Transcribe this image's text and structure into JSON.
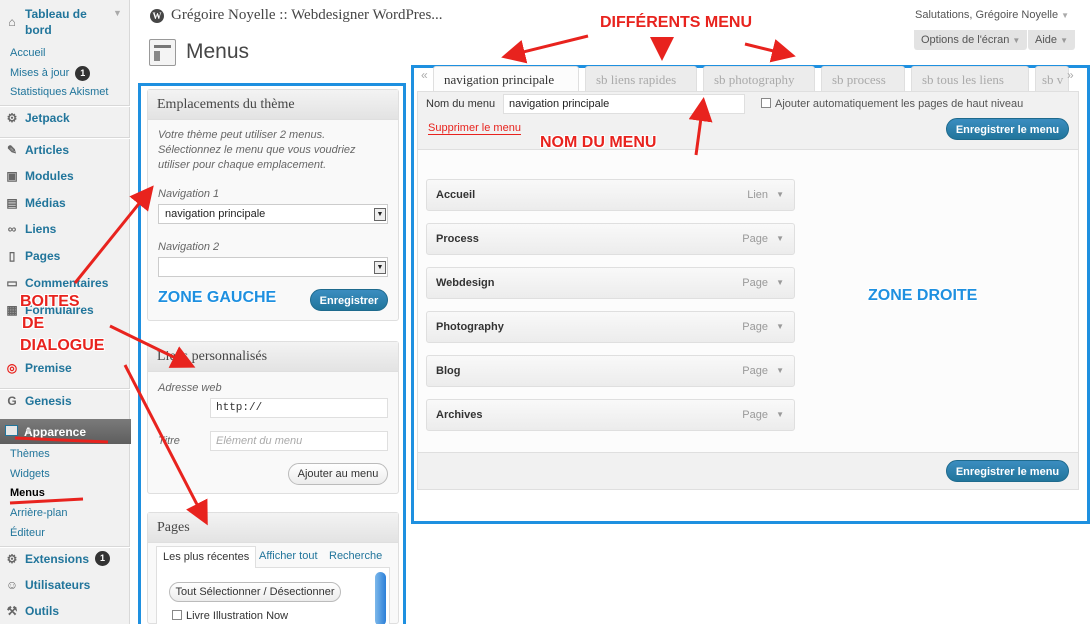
{
  "header": {
    "site_title": "Grégoire Noyelle :: Webdesigner WordPres...",
    "greeting": "Salutations, Grégoire Noyelle",
    "screen_options": "Options de l'écran",
    "help": "Aide"
  },
  "page": {
    "title": "Menus"
  },
  "sidebar": {
    "dashboard": "Tableau de",
    "dashboard2": "bord",
    "sub": [
      "Accueil",
      "Mises à jour",
      "Statistiques Akismet"
    ],
    "updates_count": "1",
    "items": [
      {
        "label": "Jetpack",
        "icon": "jetpack-icon"
      },
      {
        "label": "Articles",
        "icon": "pin-icon"
      },
      {
        "label": "Modules",
        "icon": "modules-icon"
      },
      {
        "label": "Médias",
        "icon": "media-icon"
      },
      {
        "label": "Liens",
        "icon": "link-icon"
      },
      {
        "label": "Pages",
        "icon": "pages-icon"
      },
      {
        "label": "Commentaires",
        "icon": "comment-icon"
      },
      {
        "label": "Formulaires",
        "icon": "form-icon"
      },
      {
        "label": "Premise",
        "icon": "premise-icon"
      },
      {
        "label": "Genesis",
        "icon": "genesis-icon"
      },
      {
        "label": "Apparence",
        "icon": "appearance-icon"
      },
      {
        "label": "Extensions",
        "icon": "plugins-icon"
      },
      {
        "label": "Utilisateurs",
        "icon": "users-icon"
      },
      {
        "label": "Outils",
        "icon": "tools-icon"
      }
    ],
    "appearance_sub": [
      "Thèmes",
      "Widgets",
      "Menus",
      "Arrière-plan",
      "Éditeur"
    ],
    "extensions_count": "1"
  },
  "theme_locations": {
    "title": "Emplacements du thème",
    "desc": "Votre thème peut utiliser 2 menus. Sélectionnez le menu que vous voudriez utiliser pour chaque emplacement.",
    "nav1_label": "Navigation 1",
    "nav1_value": "navigation principale",
    "nav2_label": "Navigation 2",
    "nav2_value": "",
    "save": "Enregistrer"
  },
  "custom_links": {
    "title": "Liens personnalisés",
    "url_label": "Adresse web",
    "url_value": "http://",
    "text_label": "Titre",
    "text_placeholder": "Elément du menu",
    "add": "Ajouter au menu"
  },
  "pages_box": {
    "title": "Pages",
    "tabs": [
      "Les plus récentes",
      "Afficher tout",
      "Recherche"
    ],
    "select_all": "Tout Sélectionner / Désectionner",
    "first_page": "Livre Illustration Now"
  },
  "menu_tabs": [
    "navigation principale",
    "sb liens rapides",
    "sb photography",
    "sb process",
    "sb tous les liens",
    "sb v"
  ],
  "menu_editor": {
    "name_label": "Nom du menu",
    "name_value": "navigation principale",
    "auto_add": "Ajouter automatiquement les pages de haut niveau",
    "delete": "Supprimer le menu",
    "save": "Enregistrer le menu"
  },
  "menu_items": [
    {
      "title": "Accueil",
      "type": "Lien"
    },
    {
      "title": "Process",
      "type": "Page"
    },
    {
      "title": "Webdesign",
      "type": "Page"
    },
    {
      "title": "Photography",
      "type": "Page"
    },
    {
      "title": "Blog",
      "type": "Page"
    },
    {
      "title": "Archives",
      "type": "Page"
    }
  ],
  "annotations": {
    "different_menus": "DIFFÉRENTS MENU",
    "menu_name": "NOM DU MENU",
    "dialog_boxes_1": "BOITES",
    "dialog_boxes_2": "DE",
    "dialog_boxes_3": "DIALOGUE",
    "zone_left": "ZONE GAUCHE",
    "zone_right": "ZONE DROITE"
  },
  "colors": {
    "accent": "#21759b",
    "annotation": "#e8231e",
    "zone_border": "#1e90e0"
  }
}
